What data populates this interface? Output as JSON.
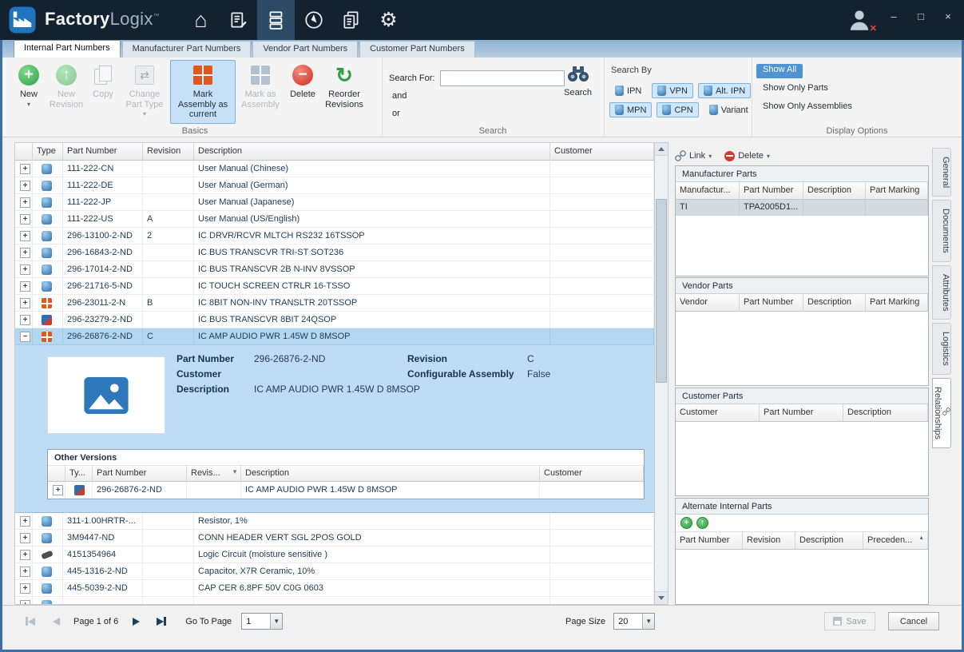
{
  "titlebar": {
    "brand": {
      "primary": "Factory",
      "secondary": "Logix",
      "trademark": "™"
    },
    "window_controls": {
      "minimize": "–",
      "maximize": "□",
      "close": "×"
    }
  },
  "tabs": [
    {
      "label": "Internal Part Numbers",
      "active": true
    },
    {
      "label": "Manufacturer Part Numbers",
      "active": false
    },
    {
      "label": "Vendor Part Numbers",
      "active": false
    },
    {
      "label": "Customer Part Numbers",
      "active": false
    }
  ],
  "ribbon": {
    "groups": {
      "basics": {
        "caption": "Basics"
      },
      "search": {
        "caption": "Search"
      },
      "search_by": {
        "caption": "Search By"
      },
      "display_options": {
        "caption": "Display Options"
      }
    },
    "buttons": {
      "new": "New",
      "new_revision": "New Revision",
      "copy": "Copy",
      "change_part_type": "Change Part Type",
      "mark_assembly_current": "Mark Assembly as current",
      "mark_as_assembly": "Mark as Assembly",
      "delete": "Delete",
      "reorder_revisions": "Reorder Revisions"
    },
    "search": {
      "search_for_label": "Search For:",
      "search_value": "",
      "and_label": "and",
      "or_label": "or",
      "search_button_label": "Search"
    },
    "search_by_buttons": [
      {
        "label": "IPN",
        "icon": "part",
        "selected": false
      },
      {
        "label": "VPN",
        "icon": "part",
        "selected": true
      },
      {
        "label": "Alt. IPN",
        "icon": "part",
        "selected": true
      },
      {
        "label": "MPN",
        "icon": "part",
        "selected": true
      },
      {
        "label": "CPN",
        "icon": "part",
        "selected": true
      },
      {
        "label": "Variant",
        "icon": "variant",
        "selected": false
      }
    ],
    "display_options": [
      {
        "label": "Show All",
        "selected": true
      },
      {
        "label": "Show Only Parts",
        "selected": false
      },
      {
        "label": "Show Only Assemblies",
        "selected": false
      }
    ]
  },
  "main_table": {
    "columns": {
      "type": "Type",
      "part_number": "Part Number",
      "revision": "Revision",
      "description": "Description",
      "customer": "Customer"
    },
    "rows_above": [
      {
        "icon": "part",
        "part_number": "111-222-CN",
        "revision": "",
        "description": "User Manual (Chinese)",
        "customer": ""
      },
      {
        "icon": "part",
        "part_number": "111-222-DE",
        "revision": "",
        "description": "User Manual (German)",
        "customer": ""
      },
      {
        "icon": "part",
        "part_number": "111-222-JP",
        "revision": "",
        "description": "User Manual (Japanese)",
        "customer": ""
      },
      {
        "icon": "part",
        "part_number": "111-222-US",
        "revision": "A",
        "description": "User Manual (US/English)",
        "customer": ""
      },
      {
        "icon": "part",
        "part_number": "296-13100-2-ND",
        "revision": "2",
        "description": "IC DRVR/RCVR MLTCH RS232 16TSSOP",
        "customer": ""
      },
      {
        "icon": "part",
        "part_number": "296-16843-2-ND",
        "revision": "",
        "description": "IC BUS TRANSCVR TRI-ST SOT236",
        "customer": ""
      },
      {
        "icon": "part",
        "part_number": "296-17014-2-ND",
        "revision": "",
        "description": "IC BUS TRANSCVR 2B N-INV 8VSSOP",
        "customer": ""
      },
      {
        "icon": "part",
        "part_number": "296-21716-5-ND",
        "revision": "",
        "description": "IC TOUCH SCREEN CTRLR 16-TSSO",
        "customer": ""
      },
      {
        "icon": "assembly",
        "part_number": "296-23011-2-N",
        "revision": "B",
        "description": "IC 8BIT NON-INV TRANSLTR 20TSSOP",
        "customer": ""
      },
      {
        "icon": "board",
        "part_number": "296-23279-2-ND",
        "revision": "",
        "description": "IC BUS TRANSCVR 8BIT 24QSOP",
        "customer": ""
      }
    ],
    "selected_row": {
      "icon": "assembly",
      "part_number": "296-26876-2-ND",
      "revision": "C",
      "description": "IC AMP AUDIO PWR 1.45W D 8MSOP",
      "customer": ""
    },
    "rows_below": [
      {
        "icon": "part",
        "part_number": "311-1.00HRTR-...",
        "revision": "",
        "description": "Resistor, 1%",
        "customer": ""
      },
      {
        "icon": "part",
        "part_number": "3M9447-ND",
        "revision": "",
        "description": "CONN HEADER VERT SGL 2POS GOLD",
        "customer": ""
      },
      {
        "icon": "chip",
        "part_number": "4151354964",
        "revision": "",
        "description": "Logic Circuit (moisture sensitive )",
        "customer": ""
      },
      {
        "icon": "part",
        "part_number": "445-1316-2-ND",
        "revision": "",
        "description": "Capacitor,  X7R Ceramic, 10%",
        "customer": ""
      },
      {
        "icon": "part",
        "part_number": "445-5039-2-ND",
        "revision": "",
        "description": "CAP CER 6.8PF 50V C0G 0603",
        "customer": ""
      },
      {
        "icon": "part",
        "part_number": "",
        "revision": "",
        "description": "",
        "customer": ""
      }
    ]
  },
  "detail": {
    "fields": {
      "part_number_label": "Part Number",
      "part_number": "296-26876-2-ND",
      "revision_label": "Revision",
      "revision": "C",
      "customer_label": "Customer",
      "customer": "",
      "configurable_label": "Configurable Assembly",
      "configurable": "False",
      "description_label": "Description",
      "description": "IC AMP AUDIO PWR 1.45W D 8MSOP"
    },
    "other_versions": {
      "title": "Other Versions",
      "columns": {
        "type": "Ty...",
        "part_number": "Part Number",
        "revision": "Revis...",
        "description": "Description",
        "customer": "Customer"
      },
      "rows": [
        {
          "icon": "board",
          "part_number": "296-26876-2-ND",
          "revision": "",
          "description": "IC AMP AUDIO PWR 1.45W D 8MSOP",
          "customer": ""
        }
      ]
    }
  },
  "right_panel": {
    "toolbar": {
      "link_label": "Link",
      "delete_label": "Delete"
    },
    "manufacturer_parts": {
      "title": "Manufacturer Parts",
      "columns": [
        "Manufactur...",
        "Part Number",
        "Description",
        "Part Marking"
      ],
      "rows": [
        {
          "c0": "TI",
          "c1": "TPA2005D1...",
          "c2": "",
          "c3": ""
        }
      ]
    },
    "vendor_parts": {
      "title": "Vendor Parts",
      "columns": [
        "Vendor",
        "Part Number",
        "Description",
        "Part Marking"
      ],
      "rows": []
    },
    "customer_parts": {
      "title": "Customer Parts",
      "columns": [
        "Customer",
        "Part Number",
        "Description"
      ],
      "rows": []
    },
    "alternate_internal_parts": {
      "title": "Alternate Internal Parts",
      "columns": [
        "Part Number",
        "Revision",
        "Description",
        "Preceden..."
      ],
      "rows": []
    }
  },
  "side_tabs": [
    {
      "label": "General",
      "active": false
    },
    {
      "label": "Documents",
      "active": false
    },
    {
      "label": "Attributes",
      "active": false
    },
    {
      "label": "Logistics",
      "active": false
    },
    {
      "label": "Relationships",
      "active": true
    }
  ],
  "footer": {
    "page_label": "Page 1 of 6",
    "goto_label": "Go To Page",
    "goto_value": "1",
    "page_size_label": "Page Size",
    "page_size_value": "20",
    "save_label": "Save",
    "cancel_label": "Cancel"
  }
}
